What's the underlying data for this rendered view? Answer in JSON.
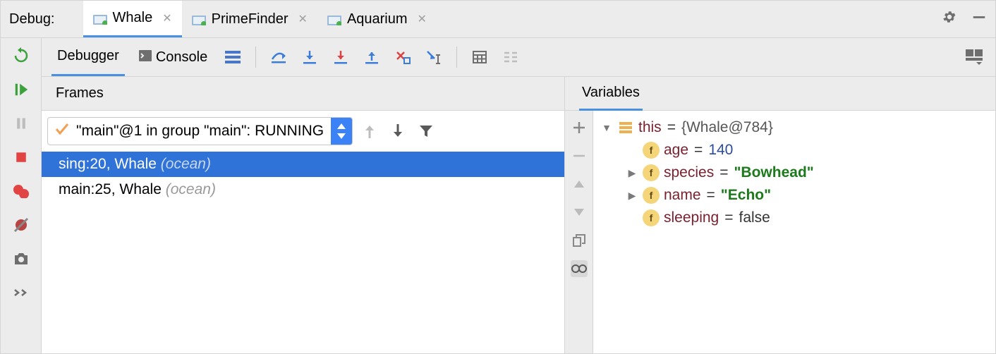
{
  "titlebar": {
    "label": "Debug:"
  },
  "tabs": [
    {
      "label": "Whale",
      "active": true
    },
    {
      "label": "PrimeFinder",
      "active": false
    },
    {
      "label": "Aquarium",
      "active": false
    }
  ],
  "toolbar": {
    "debugger_label": "Debugger",
    "console_label": "Console"
  },
  "frames": {
    "header": "Frames",
    "thread_text": "\"main\"@1 in group \"main\": RUNNING",
    "rows": [
      {
        "loc": "sing:20, Whale",
        "pkg": "(ocean)",
        "selected": true
      },
      {
        "loc": "main:25, Whale",
        "pkg": "(ocean)",
        "selected": false
      }
    ]
  },
  "variables": {
    "header": "Variables",
    "tree": {
      "this_name": "this",
      "this_val": "{Whale@784}",
      "age_name": "age",
      "age_val": "140",
      "species_name": "species",
      "species_val": "\"Bowhead\"",
      "name_name": "name",
      "name_val": "\"Echo\"",
      "sleeping_name": "sleeping",
      "sleeping_val": "false"
    }
  }
}
